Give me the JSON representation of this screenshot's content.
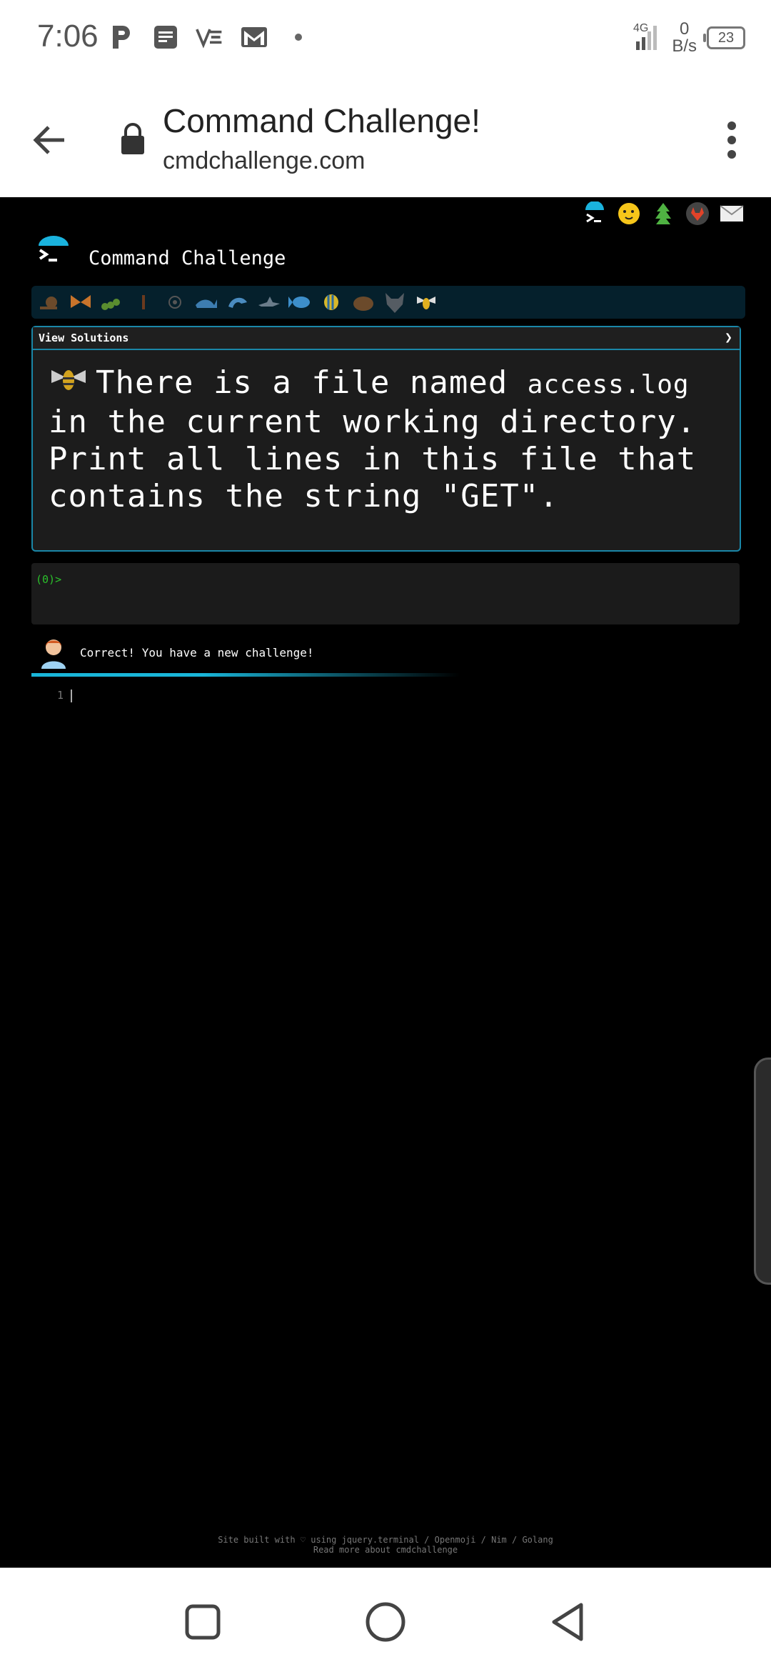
{
  "status_bar": {
    "time": "7:06",
    "notification_icons": [
      "parking-icon",
      "notes-icon",
      "vs-icon",
      "gmail-icon",
      "dot-icon"
    ],
    "network": "4G",
    "speed_value": "0",
    "speed_unit": "B/s",
    "battery": "23"
  },
  "browser": {
    "title": "Command Challenge!",
    "url": "cmdchallenge.com"
  },
  "site": {
    "title": "Command Challenge",
    "social_icons": [
      "terminal-icon",
      "emoji-icon",
      "tree-icon",
      "gitlab-icon",
      "mail-icon"
    ],
    "levels": [
      "snail-icon",
      "butterfly-icon",
      "caterpillar-icon",
      "bug-icon",
      "shell-icon",
      "whale-icon",
      "dolphin-icon",
      "shark-icon",
      "fish-icon",
      "tropical-fish-icon",
      "hedgehog-icon",
      "wolf-icon",
      "bee-icon"
    ]
  },
  "challenge": {
    "header": "View Solutions",
    "text_before": "There is a file named ",
    "file_name": "access.log",
    "text_after": " in the current working directory. Print all lines in this file that contains the string \"GET\"."
  },
  "terminal": {
    "prompt": "(0)>"
  },
  "feedback": {
    "message": "Correct! You have a new challenge!"
  },
  "editor": {
    "line_number": "1"
  },
  "footer": {
    "line1": "Site built with ♡ using jquery.terminal / Openmoji / Nim / Golang",
    "line2": "Read more about cmdchallenge"
  },
  "colors": {
    "accent": "#1a87a8",
    "prompt_green": "#2bc02b",
    "background": "#000000"
  }
}
